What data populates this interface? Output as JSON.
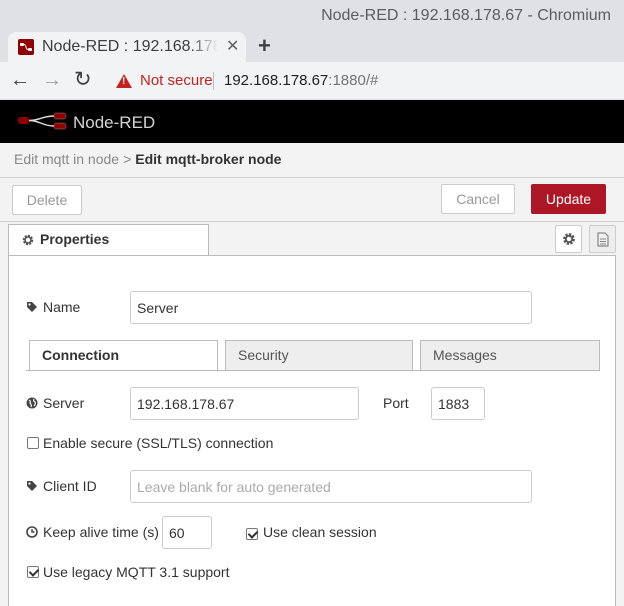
{
  "window": {
    "title": "Node-RED : 192.168.178.67 - Chromium"
  },
  "browser": {
    "tab_title": "Node-RED : 192.168.178.67:1880/#",
    "security_label": "Not secure",
    "url_host": "192.168.178.67",
    "url_rest": ":1880/#",
    "icons": [
      "back-arrow-icon",
      "forward-arrow-icon",
      "reload-icon",
      "warning-icon",
      "close-icon",
      "plus-icon"
    ]
  },
  "app": {
    "brand": "Node-RED"
  },
  "tray": {
    "breadcrumb_parent": "Edit mqtt in node",
    "breadcrumb_separator": ">",
    "breadcrumb_current": "Edit mqtt-broker node",
    "delete_label": "Delete",
    "cancel_label": "Cancel",
    "update_label": "Update",
    "update_color": "#ad1625",
    "properties_tab": "Properties"
  },
  "form": {
    "name_label": "Name",
    "name_value": "Server",
    "tabs": [
      "Connection",
      "Security",
      "Messages"
    ],
    "active_tab": "Connection",
    "server_label": "Server",
    "server_value": "192.168.178.67",
    "port_label": "Port",
    "port_value": "1883",
    "tls_label": "Enable secure (SSL/TLS) connection",
    "tls_checked": false,
    "clientid_label": "Client ID",
    "clientid_placeholder": "Leave blank for auto generated",
    "keepalive_label": "Keep alive time (s)",
    "keepalive_value": "60",
    "clean_session_label": "Use clean session",
    "clean_session_checked": true,
    "legacy_label": "Use legacy MQTT 3.1 support",
    "legacy_checked": true
  }
}
